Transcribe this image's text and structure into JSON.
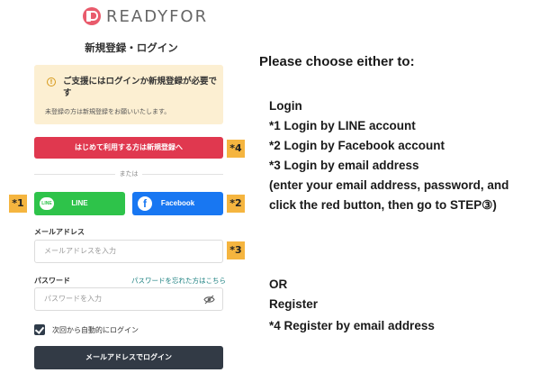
{
  "logo": {
    "text": "READYFOR"
  },
  "panel": {
    "title": "新規登録・ログイン",
    "notice": {
      "icon": "info-icon",
      "main": "ご支援にはログインか新規登録が必要です",
      "sub": "未登録の方は新規登録をお願いいたします。"
    },
    "register_button": "はじめて利用する方は新規登録へ",
    "divider": "または",
    "line_button": "LINE",
    "line_icon_text": "LINE",
    "facebook_button": "Facebook",
    "facebook_icon_text": "f",
    "email_label": "メールアドレス",
    "email_placeholder": "メールアドレスを入力",
    "password_label": "パスワード",
    "forgot_link": "パスワードを忘れた方はこちら",
    "password_placeholder": "パスワードを入力",
    "remember_label": "次回から自動的にログイン",
    "remember_checked": true,
    "email_login_button": "メールアドレスでログイン"
  },
  "tags": {
    "t1": "*1",
    "t2": "*2",
    "t3": "*3",
    "t4": "*4"
  },
  "instructions": {
    "heading": "Please choose either to:",
    "login": "Login",
    "l1": "*1 Login by LINE account",
    "l2": "*2 Login by Facebook account",
    "l3": "*3 Login by email address",
    "l4": "(enter your email address, password, and",
    "l5": "click the red button, then go to STEP③)",
    "or": "OR",
    "register": "Register",
    "l6": "*4 Register by email address"
  },
  "colors": {
    "register": "#e0384f",
    "line": "#2ec34a",
    "facebook": "#1877f2",
    "email_login": "#323a45",
    "notice_bg": "#fcefd2",
    "tag": "#f5b53f"
  }
}
